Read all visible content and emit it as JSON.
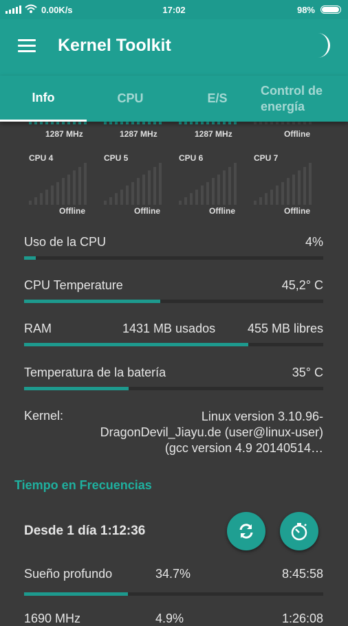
{
  "status": {
    "speed": "0.00K/s",
    "time": "17:02",
    "battery": "98%",
    "battery_level": 0.98
  },
  "app": {
    "title": "Kernel Toolkit"
  },
  "tabs": [
    {
      "label": "Info"
    },
    {
      "label": "CPU"
    },
    {
      "label": "E/S"
    },
    {
      "label_line1": "Control de",
      "label_line2": "energía"
    }
  ],
  "cpus_top": [
    {
      "status": "1287 MHz"
    },
    {
      "status": "1287 MHz"
    },
    {
      "status": "1287 MHz"
    },
    {
      "status": "Offline"
    }
  ],
  "cpus": [
    {
      "name": "CPU 4",
      "status": "Offline"
    },
    {
      "name": "CPU 5",
      "status": "Offline"
    },
    {
      "name": "CPU 6",
      "status": "Offline"
    },
    {
      "name": "CPU 7",
      "status": "Offline"
    }
  ],
  "stats": {
    "cpu_usage": {
      "label": "Uso de la CPU",
      "value": "4%",
      "level": 0.04
    },
    "cpu_temp": {
      "label": "CPU Temperature",
      "value": "45,2° C",
      "level": 0.455
    },
    "ram": {
      "label": "RAM",
      "used": "1431 MB usados",
      "free": "455 MB libres",
      "level": 0.75
    },
    "battery_temp": {
      "label": "Temperatura de la batería",
      "value": "35° C",
      "level": 0.35
    }
  },
  "kernel": {
    "label": "Kernel:",
    "line1": "Linux version 3.10.96-",
    "line2": "DragonDevil_Jiayu.de (user@linux-user)",
    "line3": "(gcc version 4.9 20140514…"
  },
  "freq": {
    "section_title": "Tiempo en Frecuencias",
    "since": "Desde 1 día 1:12:36",
    "deep_sleep_label": "Sueño profundo",
    "deep_sleep_pct": "34.7%",
    "deep_sleep_time": "8:45:58",
    "deep_sleep_level": 0.347,
    "next_row_label": "1690 MHz",
    "next_row_pct": "4.9%",
    "next_row_time": "1:26:08"
  },
  "icons": {
    "menu": "menu-icon",
    "theme": "moon-icon",
    "refresh": "refresh-icon",
    "timer": "stopwatch-icon"
  },
  "colors": {
    "primary": "#1f9f92",
    "background": "#3a3a3a",
    "accent": "#1fb09f"
  }
}
